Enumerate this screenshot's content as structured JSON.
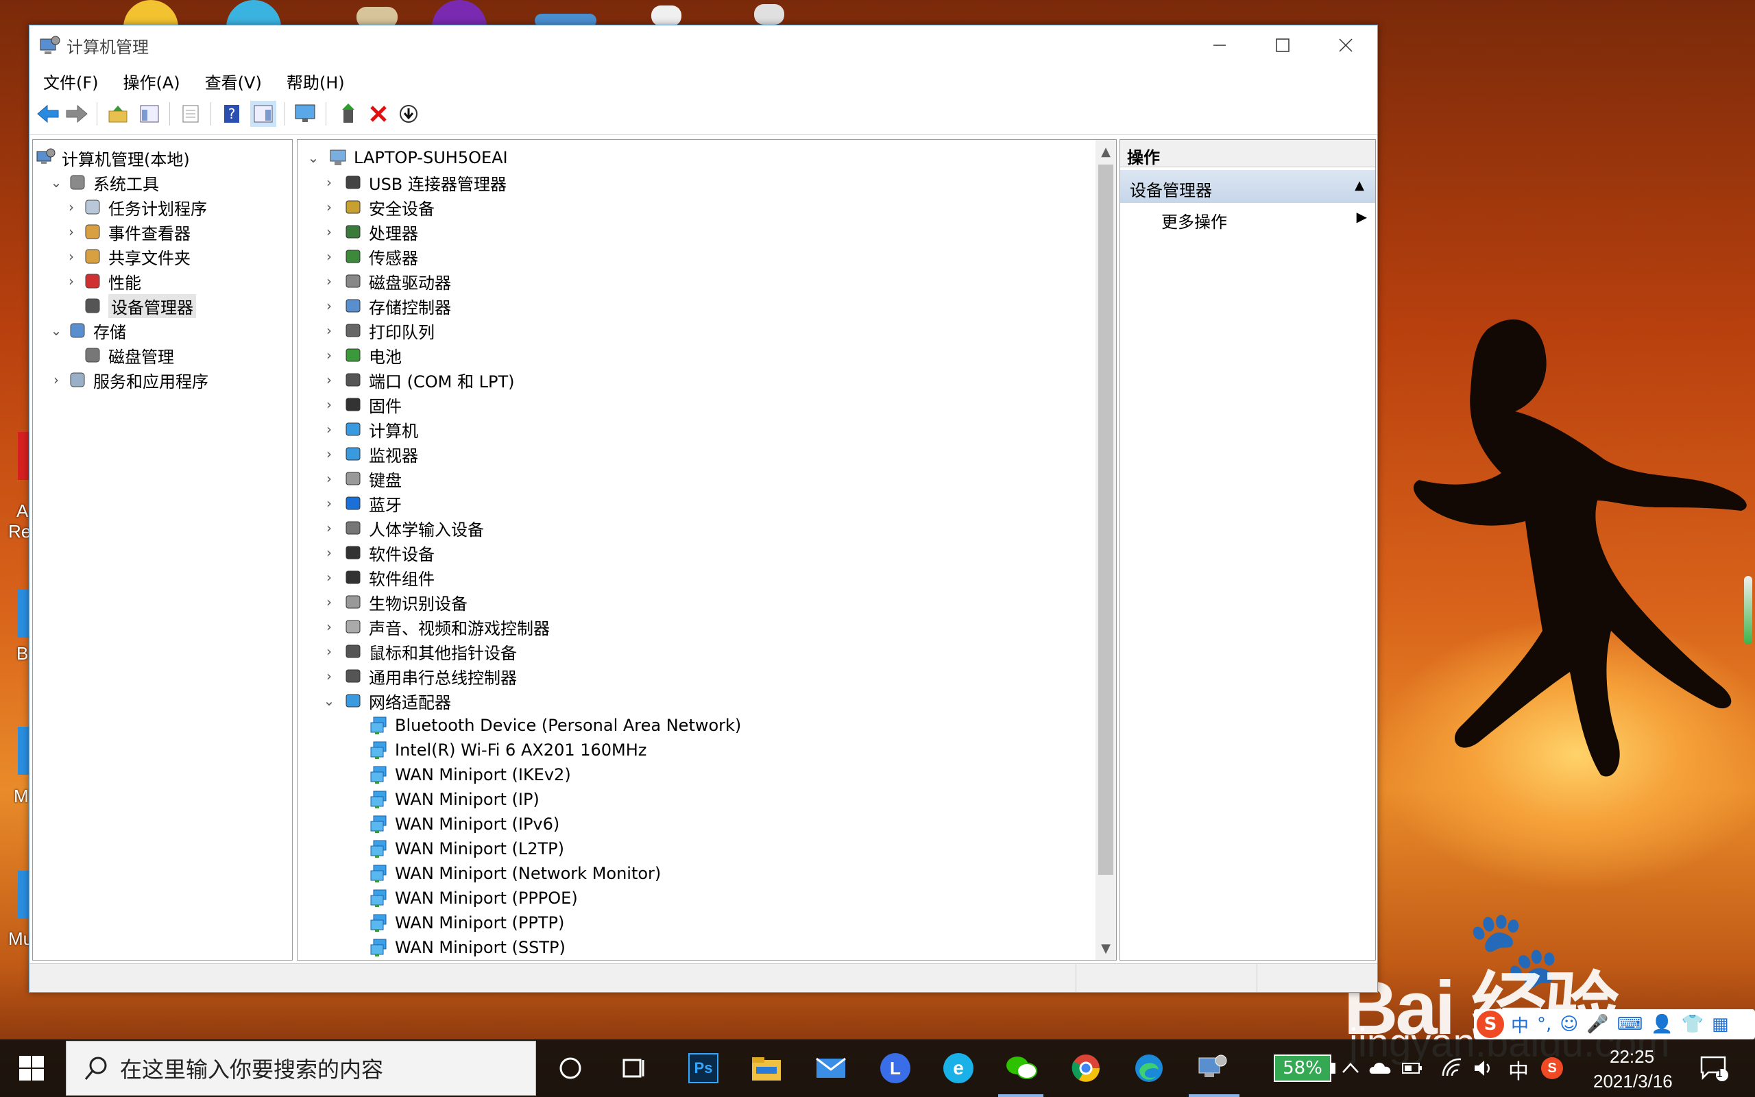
{
  "window": {
    "title": "计算机管理",
    "menu": [
      "文件(F)",
      "操作(A)",
      "查看(V)",
      "帮助(H)"
    ]
  },
  "left_tree": {
    "root": "计算机管理(本地)",
    "items": [
      {
        "label": "系统工具",
        "level": 1,
        "expanded": true
      },
      {
        "label": "任务计划程序",
        "level": 2,
        "expanded": false
      },
      {
        "label": "事件查看器",
        "level": 2,
        "expanded": false
      },
      {
        "label": "共享文件夹",
        "level": 2,
        "expanded": false
      },
      {
        "label": "性能",
        "level": 2,
        "expanded": false
      },
      {
        "label": "设备管理器",
        "level": 2,
        "selected": true
      },
      {
        "label": "存储",
        "level": 1,
        "expanded": true
      },
      {
        "label": "磁盘管理",
        "level": 2
      },
      {
        "label": "服务和应用程序",
        "level": 1,
        "expanded": false
      }
    ]
  },
  "device_tree": {
    "root": "LAPTOP-SUH5OEAI",
    "categories": [
      "USB 连接器管理器",
      "安全设备",
      "处理器",
      "传感器",
      "磁盘驱动器",
      "存储控制器",
      "打印队列",
      "电池",
      "端口 (COM 和 LPT)",
      "固件",
      "计算机",
      "监视器",
      "键盘",
      "蓝牙",
      "人体学输入设备",
      "软件设备",
      "软件组件",
      "生物识别设备",
      "声音、视频和游戏控制器",
      "鼠标和其他指针设备",
      "通用串行总线控制器",
      "网络适配器"
    ],
    "expanded_category": "网络适配器",
    "network_adapters": [
      "Bluetooth Device (Personal Area Network)",
      "Intel(R) Wi-Fi 6 AX201 160MHz",
      "WAN Miniport (IKEv2)",
      "WAN Miniport (IP)",
      "WAN Miniport (IPv6)",
      "WAN Miniport (L2TP)",
      "WAN Miniport (Network Monitor)",
      "WAN Miniport (PPPOE)",
      "WAN Miniport (PPTP)",
      "WAN Miniport (SSTP)"
    ]
  },
  "actions": {
    "header": "操作",
    "section": "设备管理器",
    "more": "更多操作"
  },
  "taskbar": {
    "search_placeholder": "在这里输入你要搜索的内容",
    "battery": "58%",
    "ime": "中",
    "time": "22:25",
    "date": "2021/3/16",
    "notification_count": "1"
  },
  "desktop": {
    "labels": [
      "A",
      "Re",
      "B",
      "M",
      "Mu"
    ]
  },
  "watermark": {
    "logo": "Bai 经验",
    "url": "jingyan.baidu.com"
  }
}
